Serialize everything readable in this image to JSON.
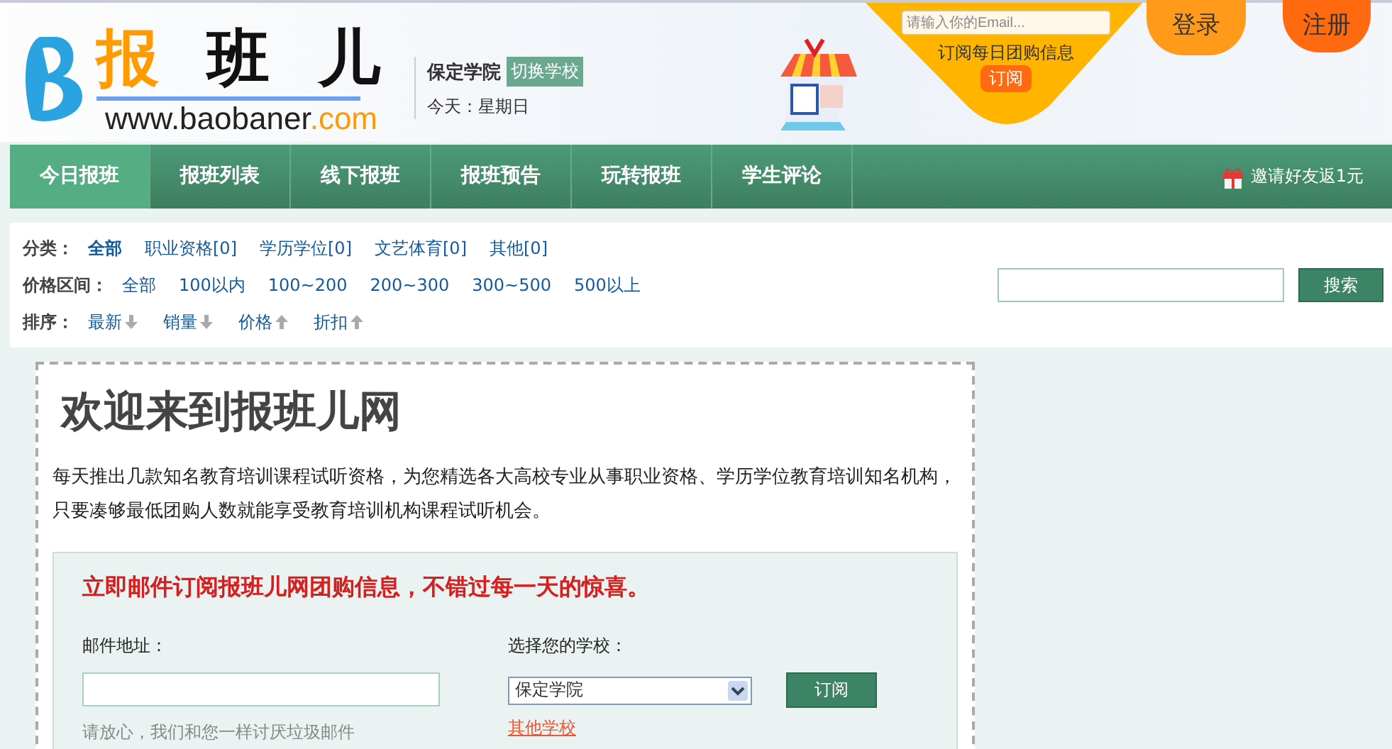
{
  "logo": {
    "chars": [
      "报",
      "班",
      "儿"
    ],
    "domain": "www.baobaner",
    "tld": ".com"
  },
  "school": {
    "name": "保定学院",
    "switch": "切换学校",
    "today": "今天：星期日"
  },
  "email_banner": {
    "placeholder": "请输入你的Email...",
    "caption": "订阅每日团购信息",
    "button": "订阅"
  },
  "auth": [
    "登录",
    "注册"
  ],
  "nav": {
    "items": [
      {
        "label": "今日报班",
        "selected": true
      },
      {
        "label": "报班列表",
        "selected": false
      },
      {
        "label": "线下报班",
        "selected": false
      },
      {
        "label": "报班预告",
        "selected": false
      },
      {
        "label": "玩转报班",
        "selected": false
      },
      {
        "label": "学生评论",
        "selected": false
      }
    ],
    "invite": "邀请好友返1元"
  },
  "filters": [
    {
      "label": "分类：",
      "options": [
        {
          "label": "全部",
          "selected": true
        },
        {
          "label": "职业资格[0]",
          "selected": false
        },
        {
          "label": "学历学位[0]",
          "selected": false
        },
        {
          "label": "文艺体育[0]",
          "selected": false
        },
        {
          "label": "其他[0]",
          "selected": false
        }
      ]
    },
    {
      "label": "价格区间：",
      "options": [
        {
          "label": "全部",
          "selected": false
        },
        {
          "label": "100以内",
          "selected": false
        },
        {
          "label": "100~200",
          "selected": false
        },
        {
          "label": "200~300",
          "selected": false
        },
        {
          "label": "300~500",
          "selected": false
        },
        {
          "label": "500以上",
          "selected": false
        }
      ]
    }
  ],
  "sort": {
    "label": "排序：",
    "options": [
      {
        "label": "最新",
        "descending": true
      },
      {
        "label": "销量",
        "descending": true
      },
      {
        "label": "价格",
        "descending": false
      },
      {
        "label": "折扣",
        "descending": false
      }
    ]
  },
  "search": {
    "button": "搜索"
  },
  "welcome": {
    "title": "欢迎来到报班儿网",
    "text": "每天推出几款知名教育培训课程试听资格，为您精选各大高校专业从事职业资格、学历学位教育培训知名机构，只要凑够最低团购人数就能享受教育培训机构课程试听机会。"
  },
  "subscribe": {
    "heading": "立即邮件订阅报班儿网团购信息，不错过每一天的惊喜。",
    "email_label": "邮件地址：",
    "email_hint": "请放心，我们和您一样讨厌垃圾邮件",
    "school_label": "选择您的学校：",
    "school_value": "保定学院",
    "button": "订阅",
    "other_link": "其他学校"
  }
}
